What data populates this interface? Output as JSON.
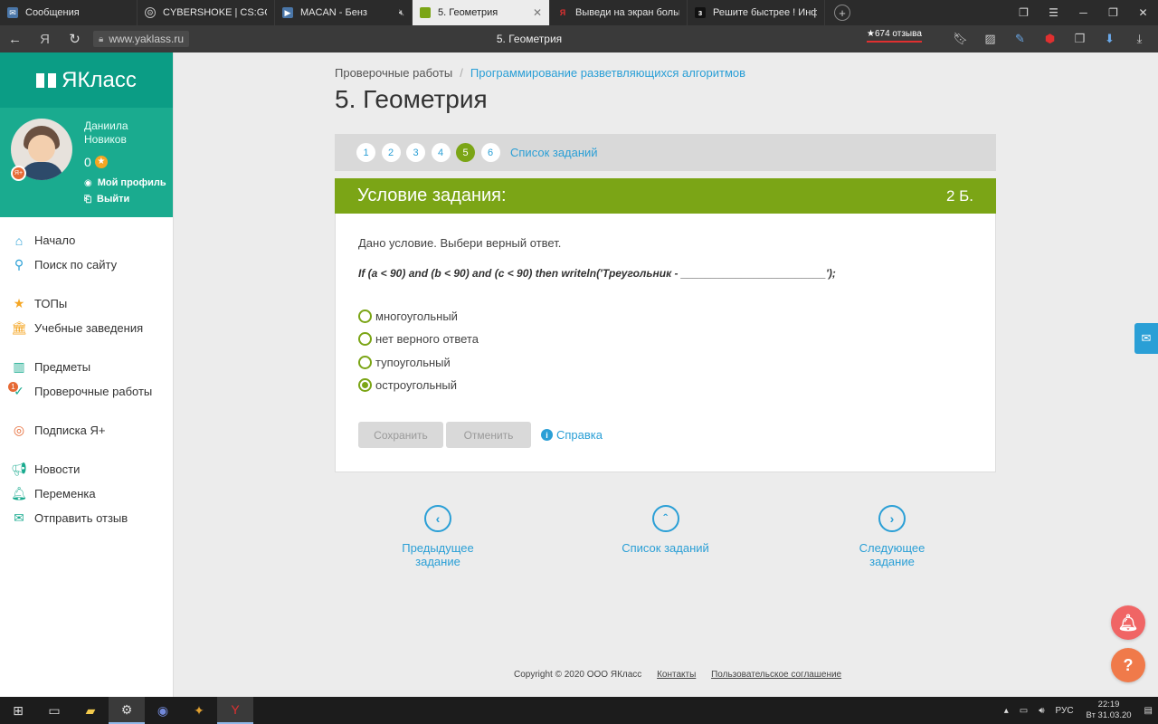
{
  "browser": {
    "tabs": [
      {
        "title": "Сообщения",
        "icon": "chat-icon",
        "color": "#4a76a8"
      },
      {
        "title": "CYBERSHOKE | CS:GO серв",
        "icon": "steam-icon",
        "color": "#666666"
      },
      {
        "title": "MACAN - Бенз",
        "icon": "video-icon",
        "color": "#4a76a8"
      },
      {
        "title": "5. Геометрия",
        "icon": "yaklass-icon",
        "color": "#7ba516"
      },
      {
        "title": "Выведи на экран больше",
        "icon": "yandex-icon",
        "color": "#e03030"
      },
      {
        "title": "Решите быстрее ! Инфор",
        "icon": "znanija-icon",
        "color": "#222222"
      }
    ],
    "url": "www.yaklass.ru",
    "page_title": "5. Геометрия",
    "reviews": "★674 отзыва"
  },
  "sidebar": {
    "brand": "ЯКласс",
    "user": {
      "name": "Даниила Новиков",
      "score": "0",
      "profile": "Мой профиль",
      "logout": "Выйти",
      "badge": "Я+"
    },
    "items": [
      {
        "label": "Начало",
        "icon": "home-icon",
        "color": "#2a9fd6"
      },
      {
        "label": "Поиск по сайту",
        "icon": "search-icon",
        "color": "#2a9fd6"
      },
      {
        "label": "ТОПы",
        "icon": "star-icon",
        "color": "#f5a623"
      },
      {
        "label": "Учебные заведения",
        "icon": "school-icon",
        "color": "#f5a623"
      },
      {
        "label": "Предметы",
        "icon": "books-icon",
        "color": "#1aab8f"
      },
      {
        "label": "Проверочные работы",
        "icon": "check-icon",
        "color": "#1aab8f",
        "count": "1"
      },
      {
        "label": "Подписка Я+",
        "icon": "subscription-icon",
        "color": "#e66a35"
      },
      {
        "label": "Новости",
        "icon": "megaphone-icon",
        "color": "#1aab8f"
      },
      {
        "label": "Переменка",
        "icon": "bell-icon",
        "color": "#1aab8f"
      },
      {
        "label": "Отправить отзыв",
        "icon": "feedback-icon",
        "color": "#1aab8f"
      }
    ]
  },
  "main": {
    "breadcrumb": {
      "parent": "Проверочные работы",
      "current": "Программирование разветвляющихся алгоритмов"
    },
    "title": "5. Геометрия",
    "pages": [
      "1",
      "2",
      "3",
      "4",
      "5",
      "6"
    ],
    "current_page": "5",
    "task_list": "Список заданий",
    "card": {
      "header": "Условие задания:",
      "points": "2 Б.",
      "condition": "Дано условие. Выбери верный ответ.",
      "code": "If (a < 90) and (b < 90) and (c < 90) then writeln('Треугольник - ________________________');",
      "options": [
        {
          "label": "многоугольный",
          "checked": false
        },
        {
          "label": "нет верного ответа",
          "checked": false
        },
        {
          "label": "тупоугольный",
          "checked": false
        },
        {
          "label": "остроугольный",
          "checked": true
        }
      ],
      "save": "Сохранить",
      "cancel": "Отменить",
      "help": "Справка"
    },
    "nav": {
      "prev": "Предыдущее задание",
      "list": "Список заданий",
      "next": "Следующее задание"
    },
    "footer": {
      "copyright": "Copyright © 2020 ООО ЯКласс",
      "contacts": "Контакты",
      "agreement": "Пользовательское соглашение"
    }
  },
  "taskbar": {
    "lang": "РУС",
    "time": "22:19",
    "date": "Вт 31.03.20"
  }
}
